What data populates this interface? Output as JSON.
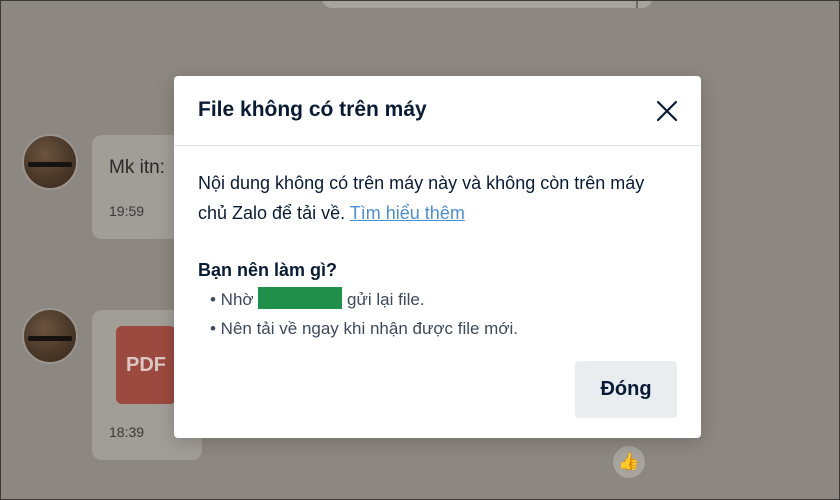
{
  "modal": {
    "title": "File không có trên máy",
    "description": "Nội dung không có trên máy này và không còn trên máy chủ Zalo để tải về.",
    "learn_more_link": "Tìm hiểu thêm",
    "question": "Bạn nên làm gì?",
    "suggestion_1_prefix": "• Nhờ",
    "suggestion_1_suffix": "gửi lại file.",
    "suggestion_2": "• Nên tải về ngay khi nhận được file mới.",
    "close_button_label": "Đóng",
    "close_icon": "close-icon"
  },
  "chat": {
    "message_1_text": "Mk itn:",
    "message_1_time": "19:59",
    "message_2_file_type": "PDF",
    "message_2_time": "18:39",
    "reaction_icon": "thumbs-up-icon"
  },
  "colors": {
    "overlay_bg": "#8c8781",
    "link": "#4c8ed8",
    "title_text": "#081c36",
    "redaction": "#1f8f4a",
    "button_bg": "#eaedf0"
  }
}
